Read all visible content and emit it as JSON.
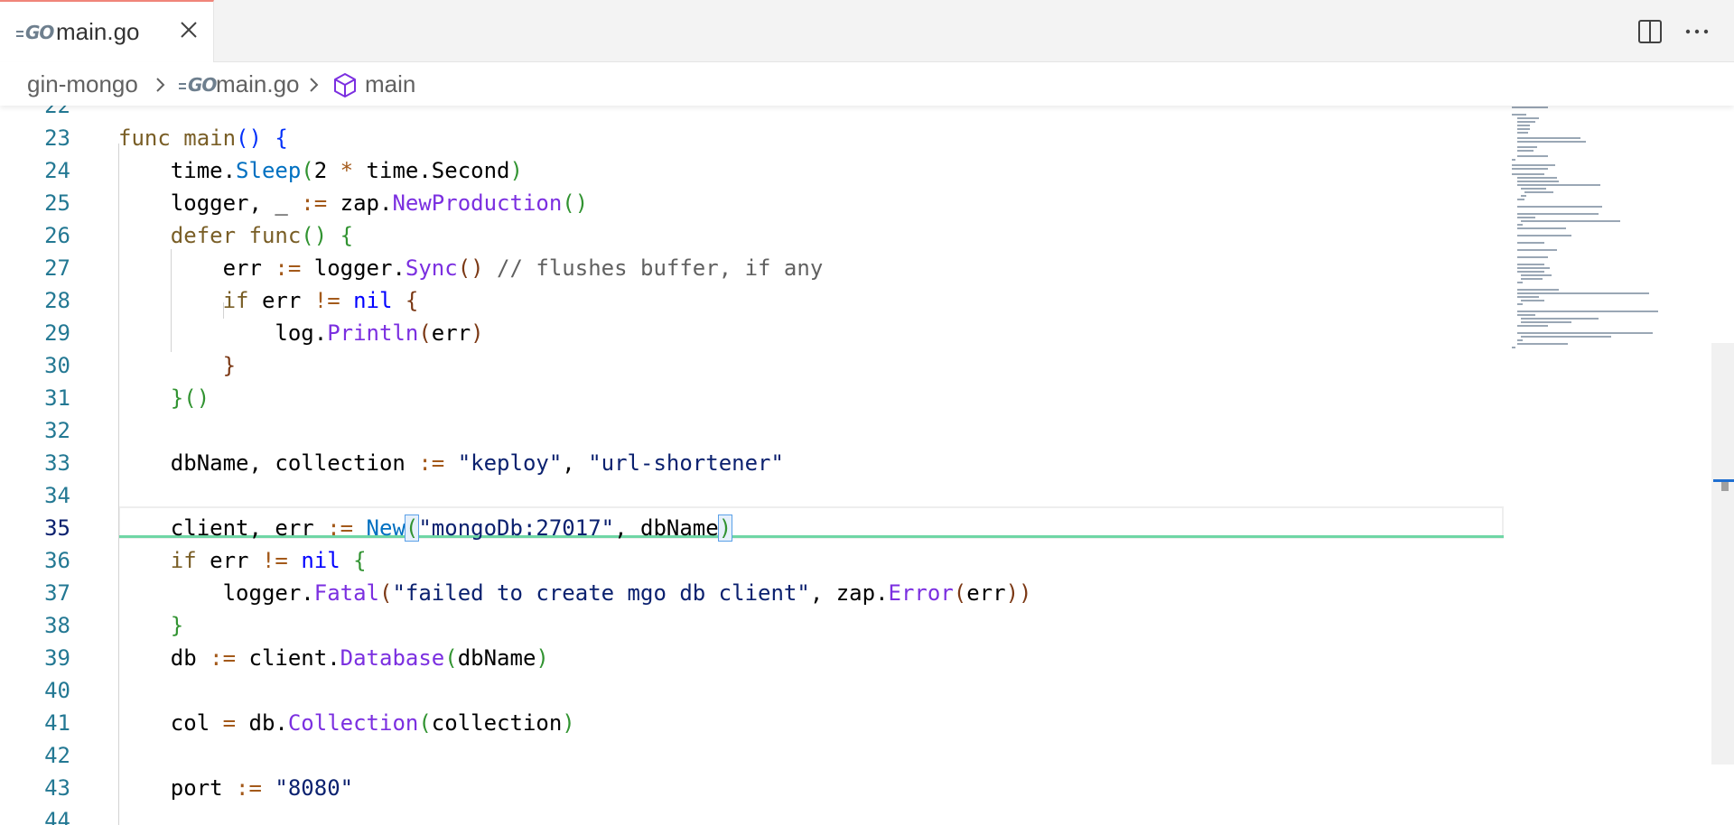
{
  "tab": {
    "label": "main.go",
    "icon": "go-file-icon",
    "accent_color": "#f0857a"
  },
  "toolbar": {
    "split_icon": "split-editor-icon",
    "more_icon": "more-actions-icon"
  },
  "breadcrumb": {
    "folder": "gin-mongo",
    "file": "main.go",
    "symbol": "main",
    "symbol_icon": "cube-icon"
  },
  "editor": {
    "current_line": 35,
    "lines": [
      {
        "n": "22"
      },
      {
        "n": "23"
      },
      {
        "n": "24"
      },
      {
        "n": "25"
      },
      {
        "n": "26"
      },
      {
        "n": "27"
      },
      {
        "n": "28"
      },
      {
        "n": "29"
      },
      {
        "n": "30"
      },
      {
        "n": "31"
      },
      {
        "n": "32"
      },
      {
        "n": "33"
      },
      {
        "n": "34"
      },
      {
        "n": "35"
      },
      {
        "n": "36"
      },
      {
        "n": "37"
      },
      {
        "n": "38"
      },
      {
        "n": "39"
      },
      {
        "n": "40"
      },
      {
        "n": "41"
      },
      {
        "n": "42"
      },
      {
        "n": "43"
      },
      {
        "n": "44"
      }
    ]
  },
  "colors": {
    "diff_added": "#6fd6a5",
    "line_number": "#237893",
    "keyword": "#795e26"
  }
}
